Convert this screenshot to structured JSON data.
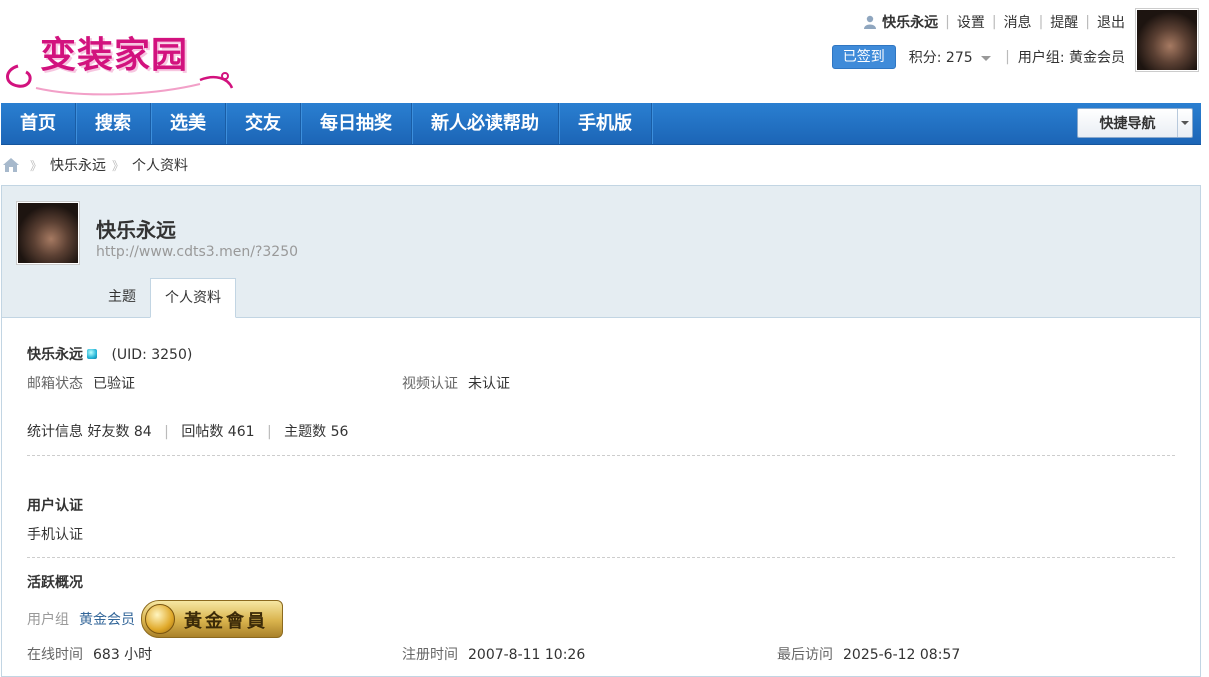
{
  "header": {
    "logo_text": "变装家园",
    "username": "快乐永远",
    "links": [
      "设置",
      "消息",
      "提醒",
      "退出"
    ],
    "signed_label": "已签到",
    "points_label": "积分: 275",
    "usergroup_label": "用户组: 黄金会员"
  },
  "nav": {
    "items": [
      "首页",
      "搜索",
      "选美",
      "交友",
      "每日抽奖",
      "新人必读帮助",
      "手机版"
    ],
    "quicknav_label": "快捷导航"
  },
  "breadcrumb": [
    "快乐永远",
    "个人资料"
  ],
  "profile": {
    "name": "快乐永远",
    "url": "http://www.cdts3.men/?3250",
    "tabs": [
      "主题",
      "个人资料"
    ],
    "active_tab": "个人资料",
    "uid_text": "(UID: 3250)",
    "email_label": "邮箱状态",
    "email_value": "已验证",
    "video_label": "视频认证",
    "video_value": "未认证",
    "stats_label": "统计信息",
    "friends": "好友数 84",
    "replies": "回帖数 461",
    "threads": "主题数 56",
    "auth_title": "用户认证",
    "auth_value": "手机认证",
    "activity_title": "活跃概况",
    "group_label": "用户组",
    "group_value": "黄金会员",
    "badge_text": "黃金會員",
    "online_label": "在线时间",
    "online_value": "683 小时",
    "reg_label": "注册时间",
    "reg_value": "2007-8-11 10:26",
    "last_label": "最后访问",
    "last_value": "2025-6-12 08:57"
  },
  "colors": {
    "nav_bg": "#1f6fc4",
    "logo": "#d2127e",
    "signed_btn": "#3f8bd9",
    "panel_head": "#e5edf2"
  }
}
